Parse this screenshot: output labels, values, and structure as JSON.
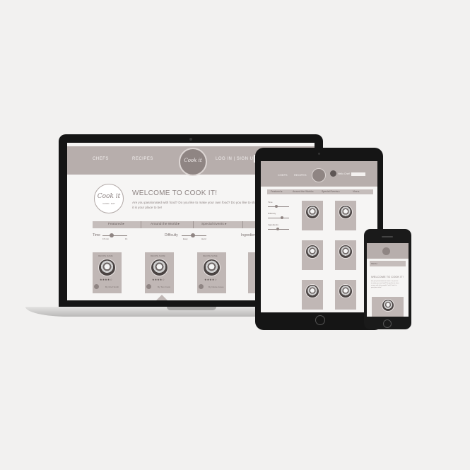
{
  "laptop": {
    "nav": {
      "chefs": "CHEFS",
      "recipes": "RECIPES",
      "login": "LOG IN | SIGN UP",
      "logo": "Cook it"
    },
    "hero": {
      "logo_text": "Cook it",
      "logo_sub": "GOOD · EAT",
      "title": "WELCOME TO COOK IT!",
      "body": "Are you passionated with food? Do you like to make your own food? Do you like to share recipes with other people? well, Cook it is your place to be!"
    },
    "tabs": [
      "Featured ▸",
      "Around the World ▸",
      "Special Events ▸"
    ],
    "filters": {
      "time": "Time",
      "time_min": "15 min",
      "time_max": "1h",
      "difficulty": "Difficulty",
      "diff_min": "Easy",
      "diff_max": "Hard",
      "ingredients": "Ingredients"
    },
    "cards": [
      {
        "top": "RECIPE NAME",
        "stars": "★★★★☆",
        "by": "By Chef Smith"
      },
      {
        "top": "RECIPE NAME",
        "stars": "★★★★☆",
        "by": "By Tom Cook"
      },
      {
        "top": "RECIPE NAME",
        "stars": "★★★★☆",
        "by": "By Nicole Jones"
      }
    ]
  },
  "tablet": {
    "nav": {
      "chefs": "CHEFS",
      "recipes": "RECIPES",
      "user": "Hello Chef!"
    },
    "tabs": [
      "Featured ▸",
      "Around the World ▸",
      "Special Events ▸",
      "Vine ▸"
    ],
    "filters": [
      "Time",
      "Difficulty",
      "Ingredients"
    ]
  },
  "phone": {
    "menu": "MENU",
    "title": "WELCOME TO COOK IT!",
    "body": "Are you passionated with food? Do you like to make your own food? Do you like to share recipes with other people? well, Cook it is your place to be!"
  },
  "colors": {
    "brand": "#b7aeac",
    "accent": "#8f8583",
    "card": "#c0b7b5"
  }
}
